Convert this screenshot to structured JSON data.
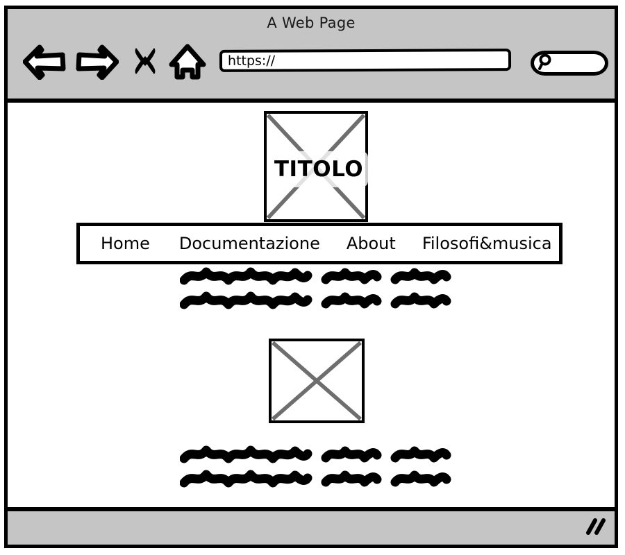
{
  "window": {
    "title": "A Web Page"
  },
  "toolbar": {
    "back_icon": "back-arrow-icon",
    "forward_icon": "forward-arrow-icon",
    "stop_icon": "stop-x-icon",
    "home_icon": "home-icon",
    "search_icon": "magnifier-icon",
    "url_value": "https://",
    "url_placeholder": "https://"
  },
  "page": {
    "logo": {
      "label": "TITOLO",
      "type": "image-placeholder"
    },
    "nav": {
      "items": [
        {
          "label": "Home"
        },
        {
          "label": "Documentazione"
        },
        {
          "label": "About"
        },
        {
          "label": "Filosofi&musica"
        }
      ]
    },
    "paragraphs": [
      {
        "name": "scribble-paragraph-1",
        "lines": [
          {
            "words": [
              185,
              95,
              105,
              55
            ]
          },
          {
            "words": [
              185,
              95,
              105,
              55
            ]
          }
        ]
      },
      {
        "name": "scribble-paragraph-2",
        "lines": [
          {
            "words": [
              185,
              95,
              105,
              55
            ]
          },
          {
            "words": [
              185,
              95,
              105,
              55
            ]
          }
        ]
      }
    ],
    "content_image": {
      "type": "image-placeholder",
      "label": ""
    }
  },
  "footer": {
    "resize_grip_icon": "resize-grip-icon"
  },
  "colors": {
    "chrome": "#c5c5c5",
    "ink": "#000000",
    "page": "#ffffff",
    "placeholder_cross": "#6e6e6e"
  }
}
